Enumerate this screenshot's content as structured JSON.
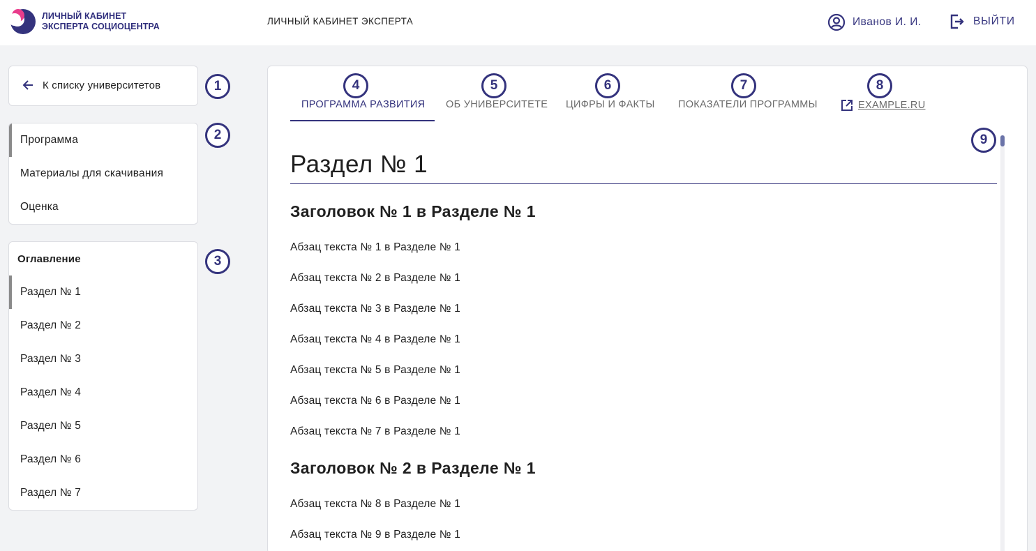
{
  "header": {
    "logo_line1": "ЛИЧНЫЙ КАБИНЕТ",
    "logo_line2": "ЭКСПЕРТА СОЦИОЦЕНТРА",
    "title": "ЛИЧНЫЙ КАБИНЕТ ЭКСПЕРТА",
    "user_name": "Иванов И. И.",
    "logout_label": "ВЫЙТИ"
  },
  "sidebar": {
    "back_label": "К списку университетов",
    "nav_items": [
      {
        "label": "Программа",
        "active": true
      },
      {
        "label": "Материалы для скачивания",
        "active": false
      },
      {
        "label": "Оценка",
        "active": false
      }
    ],
    "toc_title": "Оглавление",
    "toc_items": [
      {
        "label": "Раздел № 1",
        "active": true
      },
      {
        "label": "Раздел № 2",
        "active": false
      },
      {
        "label": "Раздел № 3",
        "active": false
      },
      {
        "label": "Раздел № 4",
        "active": false
      },
      {
        "label": "Раздел № 5",
        "active": false
      },
      {
        "label": "Раздел № 6",
        "active": false
      },
      {
        "label": "Раздел № 7",
        "active": false
      }
    ]
  },
  "tabs": [
    {
      "label": "ПРОГРАММА РАЗВИТИЯ",
      "active": true
    },
    {
      "label": "ОБ УНИВЕРСИТЕТЕ",
      "active": false
    },
    {
      "label": "ЦИФРЫ И ФАКТЫ",
      "active": false
    },
    {
      "label": "ПОКАЗАТЕЛИ ПРОГРАММЫ",
      "active": false
    },
    {
      "label": "EXAMPLE.RU",
      "active": false,
      "external": true
    }
  ],
  "badges": [
    "1",
    "2",
    "3",
    "4",
    "5",
    "6",
    "7",
    "8",
    "9"
  ],
  "content": {
    "section_title": "Раздел № 1",
    "heading1": "Заголовок № 1 в Разделе № 1",
    "paragraphs1": [
      "Абзац текста № 1 в Разделе № 1",
      "Абзац текста № 2 в Разделе № 1",
      "Абзац текста № 3 в Разделе № 1",
      "Абзац текста № 4 в Разделе № 1",
      "Абзац текста № 5 в Разделе № 1",
      "Абзац текста № 6 в Разделе № 1",
      "Абзац текста № 7 в Разделе № 1"
    ],
    "heading2": "Заголовок № 2 в Разделе № 1",
    "paragraphs2": [
      "Абзац текста № 8 в Разделе № 1",
      "Абзац текста № 9 в Разделе № 1"
    ]
  },
  "colors": {
    "brand": "#34337d",
    "page_bg": "#f2f3f5",
    "scroll_thumb": "#6a73a8"
  },
  "icons": {
    "user": "user-circle-icon",
    "logout": "logout-icon",
    "back": "arrow-left-icon",
    "external": "external-link-icon"
  }
}
